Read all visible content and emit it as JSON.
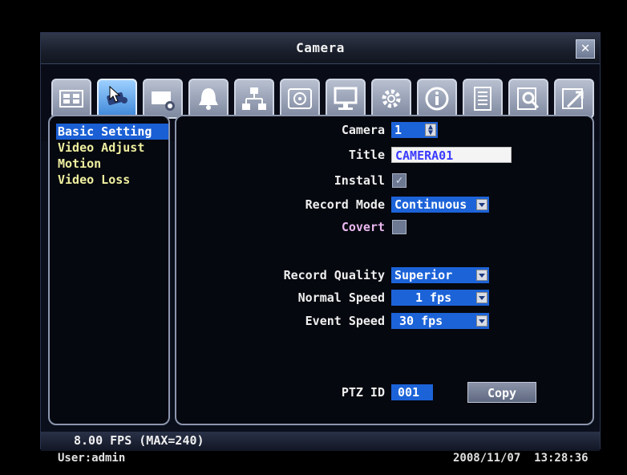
{
  "window": {
    "title": "Camera",
    "close_icon": "close-icon"
  },
  "toolbar": {
    "icons": [
      "display-icon",
      "camera-icon",
      "record-icon",
      "alarm-bell-icon",
      "network-icon",
      "disk-icon",
      "monitor-icon",
      "gear-icon",
      "info-icon",
      "schedule-icon",
      "search-icon",
      "tools-icon"
    ],
    "active_index": 1
  },
  "sidebar": {
    "items": [
      {
        "label": "Basic Setting",
        "selected": true
      },
      {
        "label": "Video Adjust",
        "selected": false
      },
      {
        "label": "Motion",
        "selected": false
      },
      {
        "label": "Video Loss",
        "selected": false
      }
    ]
  },
  "form": {
    "camera_label": "Camera",
    "camera_value": "1",
    "title_label": "Title",
    "title_value": "CAMERA01",
    "install_label": "Install",
    "install_checked": true,
    "record_mode_label": "Record Mode",
    "record_mode_value": "Continuous",
    "covert_label": "Covert",
    "covert_checked": false,
    "record_quality_label": "Record Quality",
    "record_quality_value": "Superior",
    "normal_speed_label": "Normal Speed",
    "normal_speed_value": "1 fps",
    "event_speed_label": "Event Speed",
    "event_speed_value": "30 fps",
    "ptz_id_label": "PTZ ID",
    "ptz_id_value": "001",
    "copy_label": "Copy"
  },
  "status": {
    "fps": "8.00 FPS (MAX=240)",
    "user": "User:admin",
    "datetime": "2008/11/07  13:28:36"
  },
  "colors": {
    "accent": "#1c63d8",
    "menu_text": "#f0f0a0",
    "covert_label": "#e8b8f0"
  }
}
